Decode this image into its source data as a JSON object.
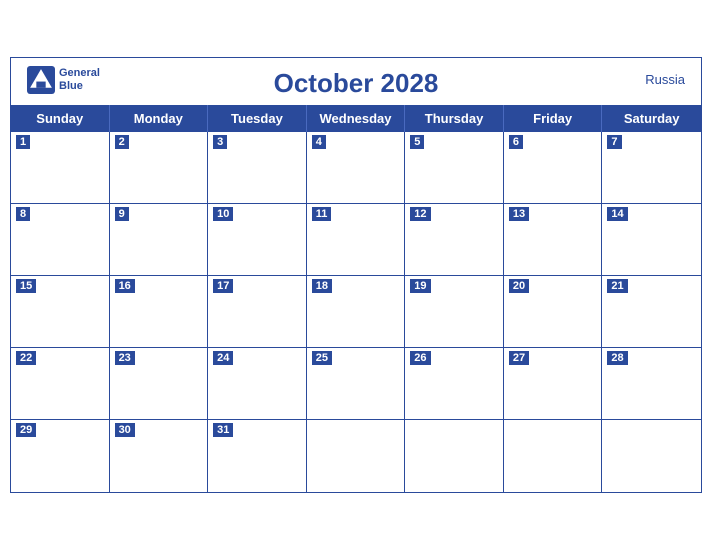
{
  "calendar": {
    "title": "October 2028",
    "country": "Russia",
    "brand_line1": "General",
    "brand_line2": "Blue",
    "days_of_week": [
      "Sunday",
      "Monday",
      "Tuesday",
      "Wednesday",
      "Thursday",
      "Friday",
      "Saturday"
    ],
    "weeks": [
      [
        {
          "date": 1,
          "empty": false
        },
        {
          "date": 2,
          "empty": false
        },
        {
          "date": 3,
          "empty": false
        },
        {
          "date": 4,
          "empty": false
        },
        {
          "date": 5,
          "empty": false
        },
        {
          "date": 6,
          "empty": false
        },
        {
          "date": 7,
          "empty": false
        }
      ],
      [
        {
          "date": 8,
          "empty": false
        },
        {
          "date": 9,
          "empty": false
        },
        {
          "date": 10,
          "empty": false
        },
        {
          "date": 11,
          "empty": false
        },
        {
          "date": 12,
          "empty": false
        },
        {
          "date": 13,
          "empty": false
        },
        {
          "date": 14,
          "empty": false
        }
      ],
      [
        {
          "date": 15,
          "empty": false
        },
        {
          "date": 16,
          "empty": false
        },
        {
          "date": 17,
          "empty": false
        },
        {
          "date": 18,
          "empty": false
        },
        {
          "date": 19,
          "empty": false
        },
        {
          "date": 20,
          "empty": false
        },
        {
          "date": 21,
          "empty": false
        }
      ],
      [
        {
          "date": 22,
          "empty": false
        },
        {
          "date": 23,
          "empty": false
        },
        {
          "date": 24,
          "empty": false
        },
        {
          "date": 25,
          "empty": false
        },
        {
          "date": 26,
          "empty": false
        },
        {
          "date": 27,
          "empty": false
        },
        {
          "date": 28,
          "empty": false
        }
      ],
      [
        {
          "date": 29,
          "empty": false
        },
        {
          "date": 30,
          "empty": false
        },
        {
          "date": 31,
          "empty": false
        },
        {
          "date": null,
          "empty": true
        },
        {
          "date": null,
          "empty": true
        },
        {
          "date": null,
          "empty": true
        },
        {
          "date": null,
          "empty": true
        }
      ]
    ]
  }
}
